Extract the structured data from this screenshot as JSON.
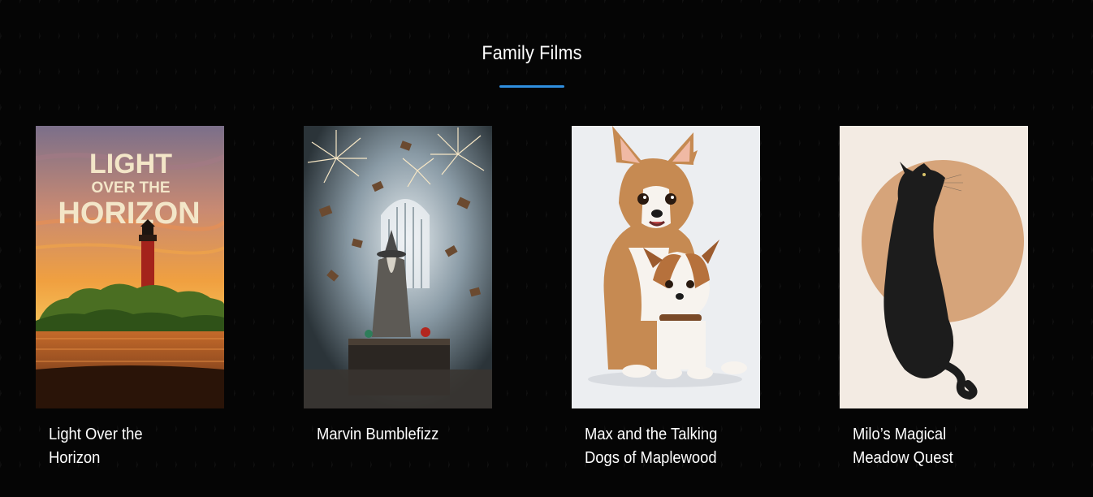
{
  "section": {
    "title": "Family Films",
    "accent_color": "#2f8fe0"
  },
  "films": [
    {
      "title": "Light Over the Horizon",
      "poster_text_line1": "LIGHT",
      "poster_text_line2": "OVER THE",
      "poster_text_line3": "HORIZON"
    },
    {
      "title": "Marvin Bumblefizz"
    },
    {
      "title": "Max and the Talking Dogs of Maplewood"
    },
    {
      "title": "Milo’s Magical Meadow Quest"
    }
  ]
}
